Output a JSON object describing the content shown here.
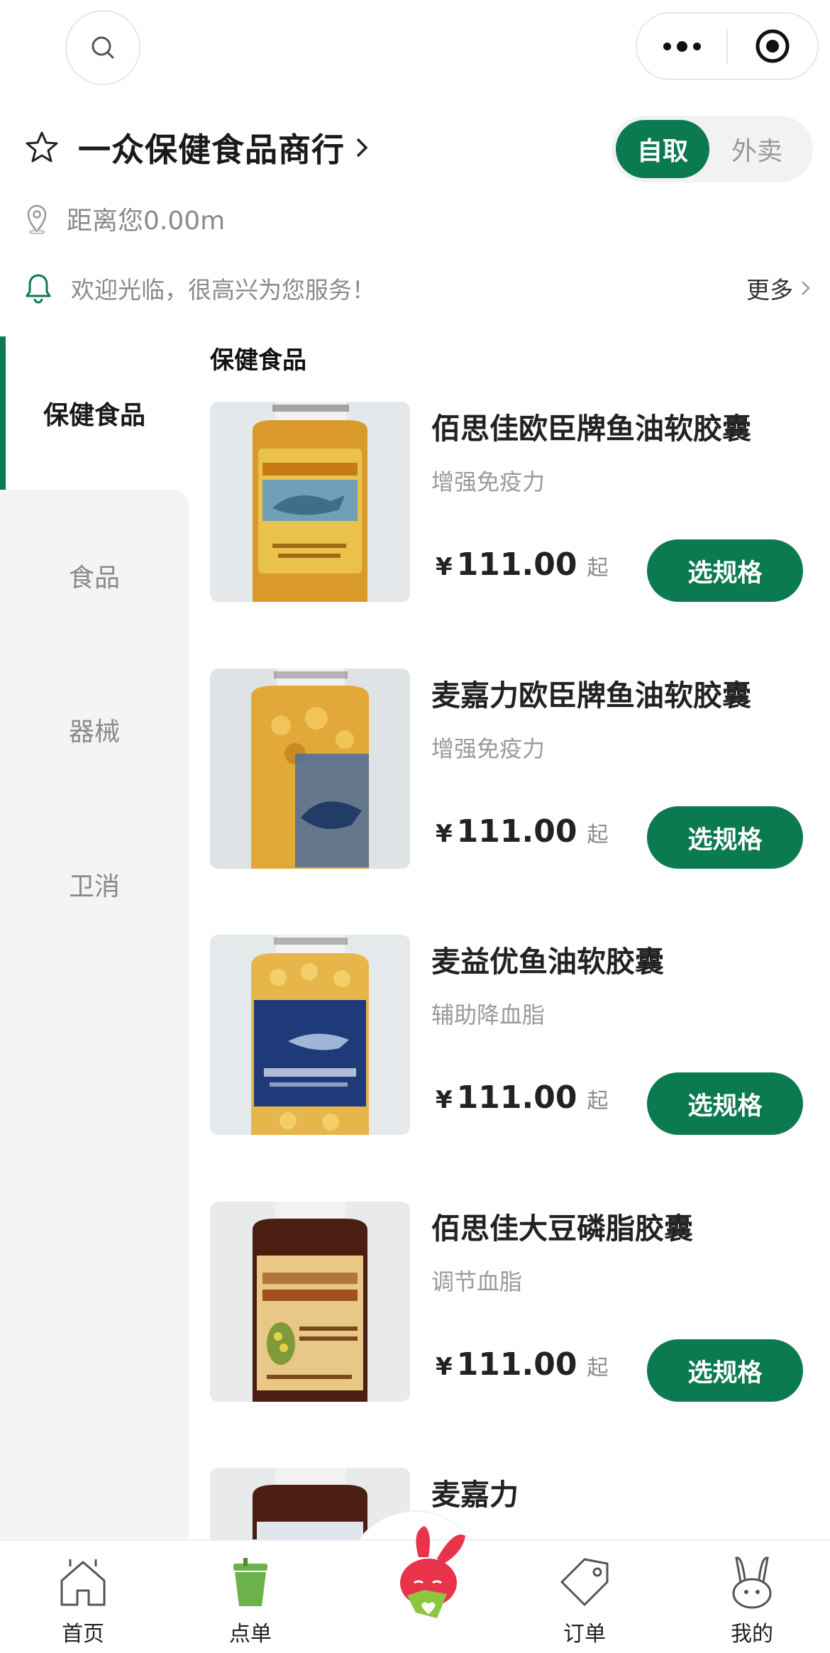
{
  "store": {
    "name": "一众保健食品商行",
    "distance": "距离您0.00m",
    "notice": "欢迎光临，很高兴为您服务！",
    "more_label": "更多"
  },
  "mode_toggle": {
    "pickup": "自取",
    "delivery": "外卖",
    "selected": "自取"
  },
  "sidebar": {
    "items": [
      {
        "label": "保健食品",
        "active": true
      },
      {
        "label": "食品",
        "active": false
      },
      {
        "label": "器械",
        "active": false
      },
      {
        "label": "卫消",
        "active": false
      }
    ]
  },
  "category_title": "保健食品",
  "products": [
    {
      "name": "佰思佳欧臣牌鱼油软胶囊",
      "desc": "增强免疫力",
      "currency": "¥",
      "price": "111.00",
      "suffix": "起",
      "button": "选规格"
    },
    {
      "name": "麦嘉力欧臣牌鱼油软胶囊",
      "desc": "增强免疫力",
      "currency": "¥",
      "price": "111.00",
      "suffix": "起",
      "button": "选规格"
    },
    {
      "name": "麦益优鱼油软胶囊",
      "desc": "辅助降血脂",
      "currency": "¥",
      "price": "111.00",
      "suffix": "起",
      "button": "选规格"
    },
    {
      "name": "佰思佳大豆磷脂胶囊",
      "desc": "调节血脂",
      "currency": "¥",
      "price": "111.00",
      "suffix": "起",
      "button": "选规格"
    },
    {
      "name": "麦嘉力",
      "desc": "",
      "currency": "",
      "price": "",
      "suffix": "",
      "button": ""
    }
  ],
  "tabbar": {
    "items": [
      {
        "label": "首页",
        "icon": "home-icon",
        "active": false
      },
      {
        "label": "点单",
        "icon": "cup-icon",
        "active": true
      },
      {
        "label": "",
        "icon": "mascot-icon",
        "active": false
      },
      {
        "label": "订单",
        "icon": "tag-icon",
        "active": false
      },
      {
        "label": "我的",
        "icon": "bunny-icon",
        "active": false
      }
    ]
  },
  "colors": {
    "brand": "#0c7a50",
    "sidebar_bg": "#f4f4f4",
    "muted_text": "#8a8a8a"
  }
}
